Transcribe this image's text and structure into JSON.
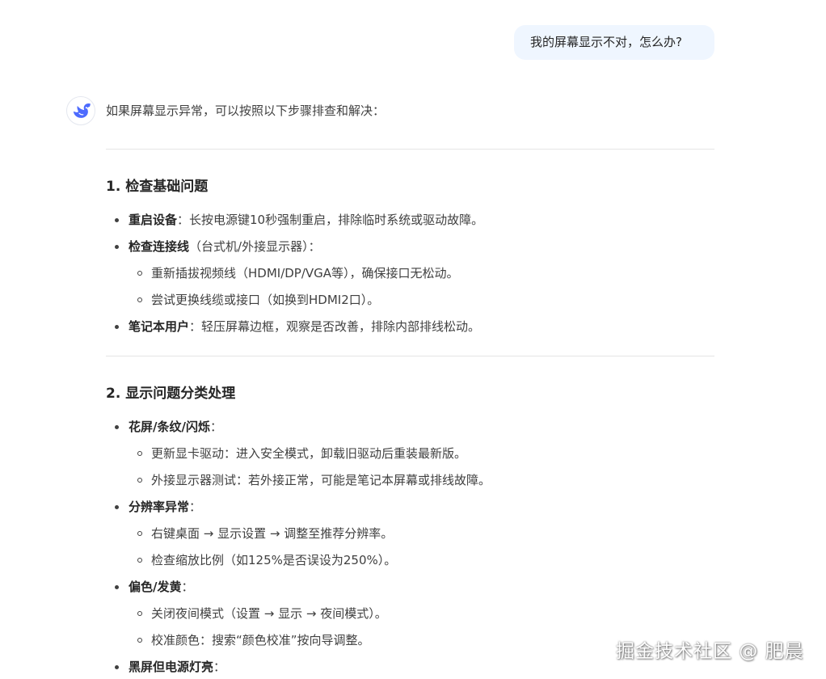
{
  "user_message": "我的屏幕显示不对，怎么办?",
  "intro": "如果屏幕显示异常，可以按照以下步骤排查和解决：",
  "section1": {
    "title": "1. 检查基础问题",
    "items": [
      {
        "bold": "重启设备",
        "text": "：长按电源键10秒强制重启，排除临时系统或驱动故障。"
      },
      {
        "bold": "检查连接线",
        "text": "（台式机/外接显示器）：",
        "sub": [
          "重新插拔视频线（HDMI/DP/VGA等），确保接口无松动。",
          "尝试更换线缆或接口（如换到HDMI2口）。"
        ]
      },
      {
        "bold": "笔记本用户",
        "text": "：轻压屏幕边框，观察是否改善，排除内部排线松动。"
      }
    ]
  },
  "section2": {
    "title": "2. 显示问题分类处理",
    "items": [
      {
        "bold": "花屏/条纹/闪烁",
        "text": "：",
        "sub": [
          "更新显卡驱动：进入安全模式，卸载旧驱动后重装最新版。",
          "外接显示器测试：若外接正常，可能是笔记本屏幕或排线故障。"
        ]
      },
      {
        "bold": "分辨率异常",
        "text": "：",
        "sub": [
          "右键桌面 → 显示设置 → 调整至推荐分辨率。",
          "检查缩放比例（如125%是否误设为250%）。"
        ]
      },
      {
        "bold": "偏色/发黄",
        "text": "：",
        "sub": [
          "关闭夜间模式（设置 → 显示 → 夜间模式）。",
          "校准颜色：搜索“颜色校准”按向导调整。"
        ]
      },
      {
        "bold": "黑屏但电源灯亮",
        "text": "："
      }
    ]
  },
  "watermark": "掘金技术社区 @ 肥晨",
  "colors": {
    "accent": "#4d6bfe",
    "bubble": "#eff6ff",
    "text": "#404040"
  },
  "icons": {
    "avatar": "deepseek-whale-icon"
  }
}
